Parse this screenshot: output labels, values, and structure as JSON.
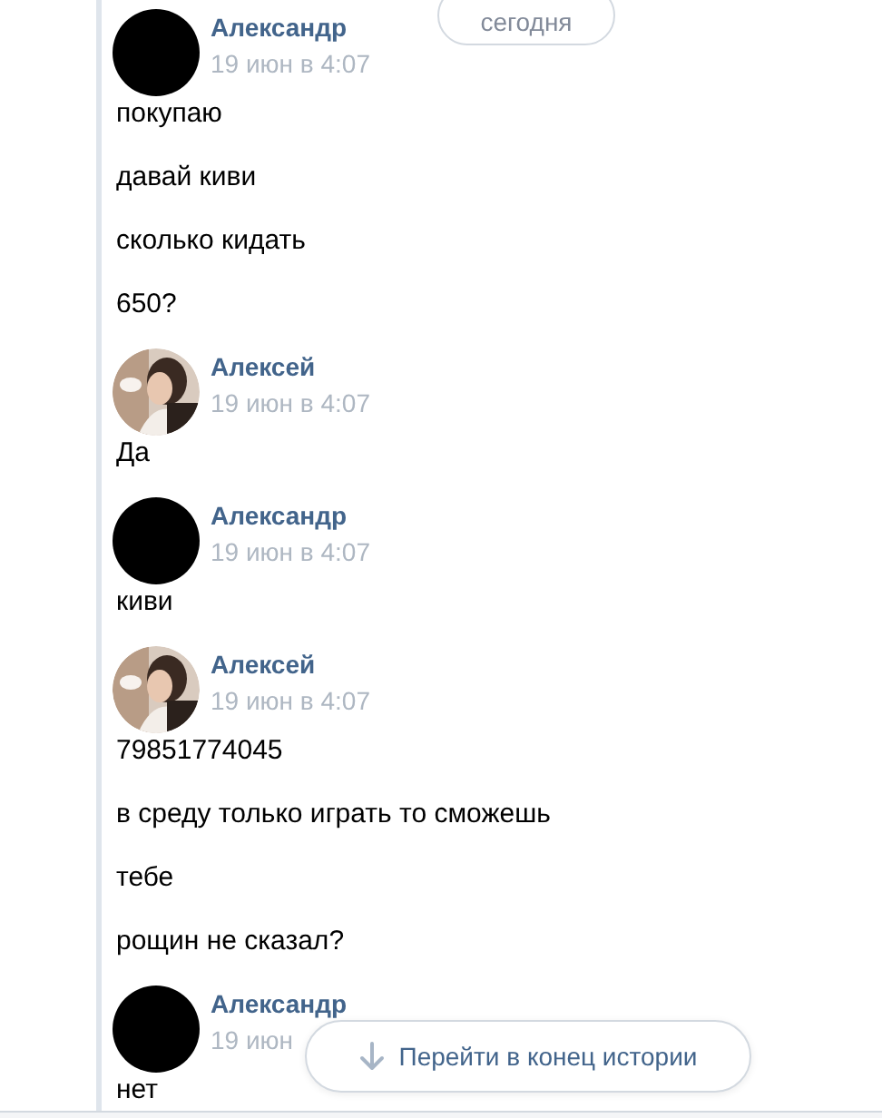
{
  "date_pill": "сегодня",
  "groups": [
    {
      "author": "Александр",
      "avatar": {
        "kind": "blank"
      },
      "time": "19 июн в 4:07",
      "messages": [
        "покупаю",
        "давай киви",
        "сколько кидать",
        "650?"
      ]
    },
    {
      "author": "Алексей",
      "avatar": {
        "kind": "picture"
      },
      "time": "19 июн в 4:07",
      "messages": [
        "Да"
      ]
    },
    {
      "author": "Александр",
      "avatar": {
        "kind": "blank"
      },
      "time": "19 июн в 4:07",
      "messages": [
        "киви"
      ]
    },
    {
      "author": "Алексей",
      "avatar": {
        "kind": "picture"
      },
      "time": "19 июн в 4:07",
      "messages": [
        "79851774045",
        "в среду только играть то сможешь",
        "тебе",
        "рощин не сказал?"
      ]
    },
    {
      "author": "Александр",
      "avatar": {
        "kind": "blank"
      },
      "time": "19 июн",
      "messages": [
        "нет"
      ]
    }
  ],
  "jump_button": "Перейти в конец истории"
}
